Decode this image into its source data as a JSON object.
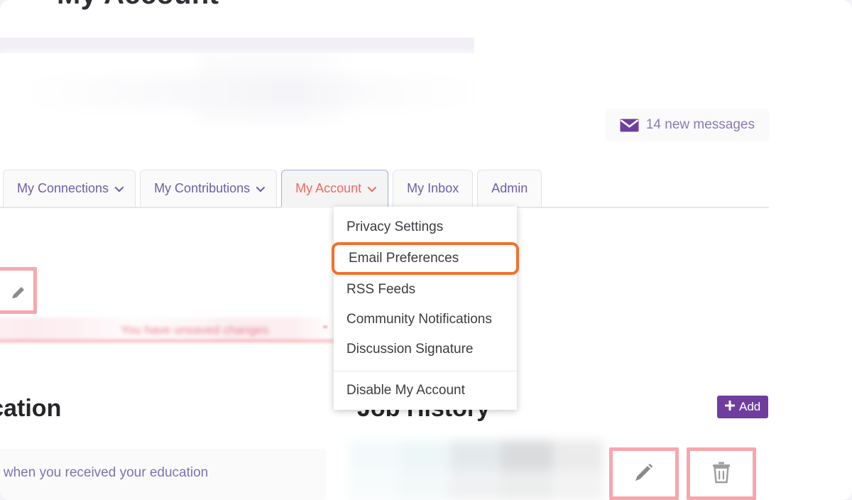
{
  "window": {
    "background": "#ffffff",
    "page_background": "#f2f1f6"
  },
  "top_region": {
    "clipped_title": "My Account",
    "note": "upper area is faded / blurred content"
  },
  "messages": {
    "icon": "envelope-icon",
    "label": "14 new messages",
    "count": 14,
    "text_color": "#8a7ab5",
    "icon_color": "#6f3d9e"
  },
  "tabbar": {
    "tabs": [
      {
        "label": "",
        "has_caret": true,
        "state": "partial",
        "caret_color": "#f4685f"
      },
      {
        "label": "My Connections",
        "has_caret": true,
        "state": "normal"
      },
      {
        "label": "My Contributions",
        "has_caret": true,
        "state": "normal"
      },
      {
        "label": "My Account",
        "has_caret": true,
        "state": "active"
      },
      {
        "label": "My Inbox",
        "has_caret": false,
        "state": "normal"
      },
      {
        "label": "Admin",
        "has_caret": false,
        "state": "normal"
      }
    ],
    "active_tab": "My Account",
    "active_text_color": "#f4685f",
    "active_border_color": "#9db4cf",
    "inactive_text_color": "#6d5fa8"
  },
  "dropdown": {
    "owner_tab": "My Account",
    "highlight_color": "#f4702a",
    "items": [
      {
        "label": "Privacy Settings",
        "highlighted": false
      },
      {
        "label": "Email Preferences",
        "highlighted": true
      },
      {
        "label": "RSS Feeds",
        "highlighted": false
      },
      {
        "label": "Community Notifications",
        "highlighted": false
      },
      {
        "label": "Discussion Signature",
        "highlighted": false
      }
    ],
    "footer_items": [
      {
        "label": "Disable My Account",
        "highlighted": false
      }
    ]
  },
  "pink_banner": {
    "text": "You have unsaved changes",
    "trailing": "\"",
    "border_color": "#f4757f"
  },
  "sections": {
    "education": {
      "heading_clipped": "Education",
      "empty_message": "Tell others where and when you received your education",
      "message_color": "#7f73ad"
    },
    "job_history": {
      "heading": "Job History",
      "add_button": {
        "label": "Add",
        "icon": "plus-icon",
        "color": "#6f3d9e"
      },
      "row_actions": [
        {
          "name": "edit",
          "icon": "pencil-icon",
          "border_color": "#f8a6ae"
        },
        {
          "name": "delete",
          "icon": "trash-icon",
          "border_color": "#f8a6ae"
        }
      ]
    }
  }
}
